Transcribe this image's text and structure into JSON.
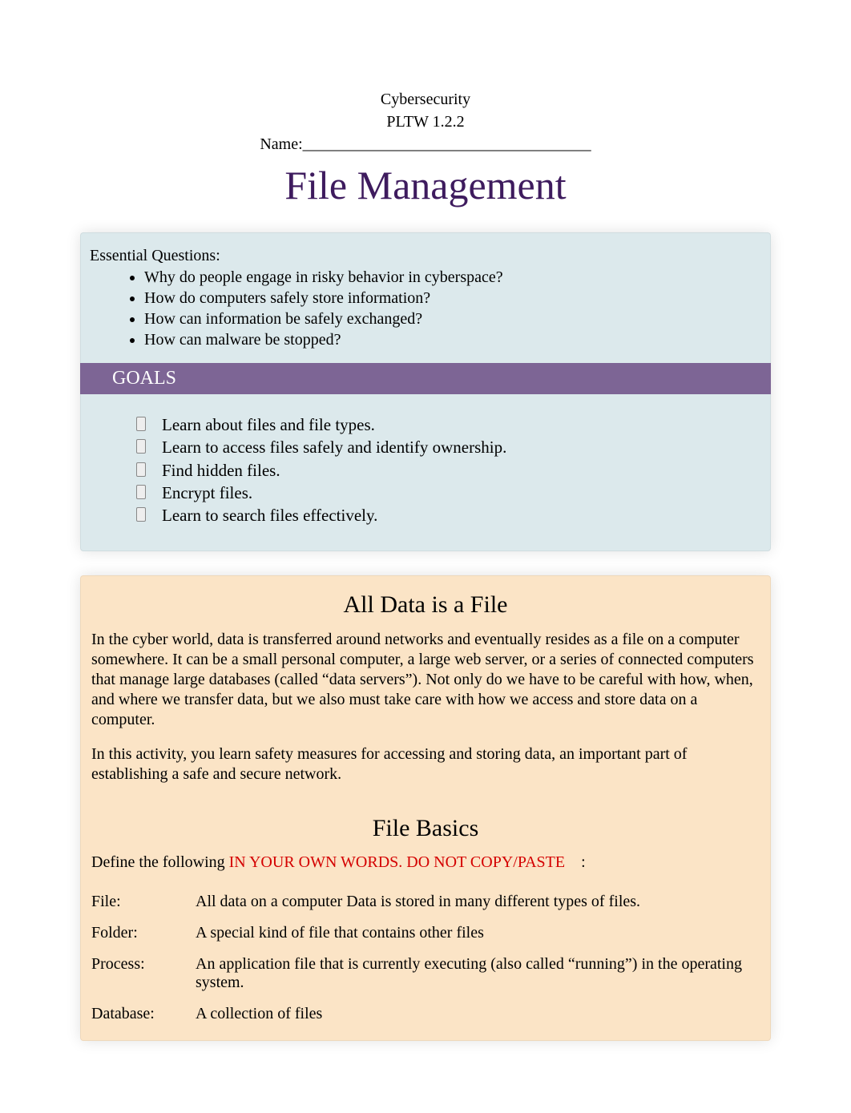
{
  "header": {
    "course": "Cybersecurity",
    "code": "PLTW 1.2.2",
    "name_label": "Name:",
    "name_line": "____________________________________"
  },
  "title": "File Management",
  "essential": {
    "heading": "Essential Questions:",
    "items": [
      "Why do people engage in risky behavior in cyberspace?",
      "How do computers safely store information?",
      "How can information be safely exchanged?",
      "How can malware be stopped?"
    ]
  },
  "goals": {
    "heading": "GOALS",
    "items": [
      "Learn about files and file types.",
      "Learn to access files safely and identify ownership.",
      "Find hidden files.",
      "Encrypt files.",
      "Learn to search files effectively."
    ]
  },
  "section1": {
    "title": "All Data is a File",
    "p1": "In the cyber world, data is transferred around networks and eventually resides as a file on a computer somewhere. It can be a small personal computer, a large web server, or a series of connected computers that manage large databases (called “data servers”). Not only do we have to be careful with how, when, and where we transfer data, but we also must take care with how we access and store data on a computer.",
    "p2": "In this activity, you learn safety measures for accessing and storing data, an important part of establishing a safe and secure network."
  },
  "section2": {
    "title": "File Basics",
    "define_prefix": "Define the following ",
    "define_red": "IN YOUR OWN WORDS. DO NOT COPY/PASTE",
    "define_suffix": ":",
    "defs": [
      {
        "term": "File:",
        "def": "All data on a computer Data is stored in many different types of files."
      },
      {
        "term": "Folder:",
        "def": "A special kind of file that contains other files"
      },
      {
        "term": "Process:",
        "def": "An application file that is currently executing (also called “running”) in the operating system."
      },
      {
        "term": "Database:",
        "def": "A collection of files"
      }
    ]
  }
}
